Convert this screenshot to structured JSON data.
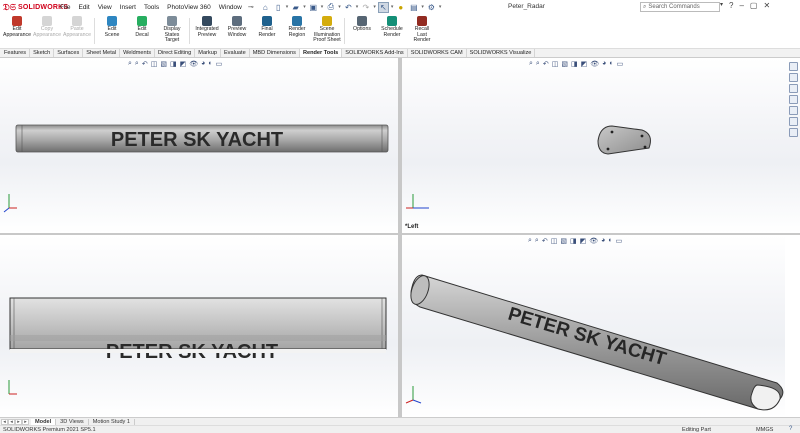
{
  "app": {
    "logo_text": "SOLIDWORKS",
    "document_title": "Peter_Radar"
  },
  "menu": [
    "File",
    "Edit",
    "View",
    "Insert",
    "Tools",
    "PhotoView 360",
    "Window"
  ],
  "search": {
    "placeholder": "Search Commands"
  },
  "ribbon": [
    {
      "label": "Edit\nAppearance",
      "enabled": true,
      "color": "#c0392b"
    },
    {
      "label": "Copy\nAppearance",
      "enabled": false,
      "color": "#888888"
    },
    {
      "label": "Paste\nAppearance",
      "enabled": false,
      "color": "#888888"
    },
    {
      "label": "Edit\nScene",
      "enabled": true,
      "color": "#2e86c1"
    },
    {
      "label": "Edit\nDecal",
      "enabled": true,
      "color": "#27ae60"
    },
    {
      "label": "Display\nStates\nTarget",
      "enabled": true,
      "color": "#7d8c99"
    },
    {
      "label": "Integrated\nPreview",
      "enabled": true,
      "color": "#34495e"
    },
    {
      "label": "Preview\nWindow",
      "enabled": true,
      "color": "#5d6d7e"
    },
    {
      "label": "Final\nRender",
      "enabled": true,
      "color": "#1f618d"
    },
    {
      "label": "Render\nRegion",
      "enabled": true,
      "color": "#2874a6"
    },
    {
      "label": "Scene\nIllumination\nProof Sheet",
      "enabled": true,
      "color": "#d4ac0d"
    },
    {
      "label": "Options",
      "enabled": true,
      "color": "#566573"
    },
    {
      "label": "Schedule\nRender",
      "enabled": true,
      "color": "#148f77"
    },
    {
      "label": "Recall\nLast\nRender",
      "enabled": true,
      "color": "#922b21"
    }
  ],
  "command_tabs": [
    "Features",
    "Sketch",
    "Surfaces",
    "Sheet Metal",
    "Weldments",
    "Direct Editing",
    "Markup",
    "Evaluate",
    "MBD Dimensions",
    "Render Tools",
    "SOLIDWORKS Add-Ins",
    "SOLIDWORKS CAM",
    "SOLIDWORKS Visualize"
  ],
  "active_command_tab": "Render Tools",
  "viewports": {
    "model_text": "PETER SK YACHT",
    "left_label": "*Left"
  },
  "bottom_tabs": [
    "Model",
    "3D Views",
    "Motion Study 1"
  ],
  "active_bottom_tab": "Model",
  "status": {
    "version": "SOLIDWORKS Premium 2021 SP5.1",
    "mode": "Editing Part",
    "units": "MMGS"
  }
}
